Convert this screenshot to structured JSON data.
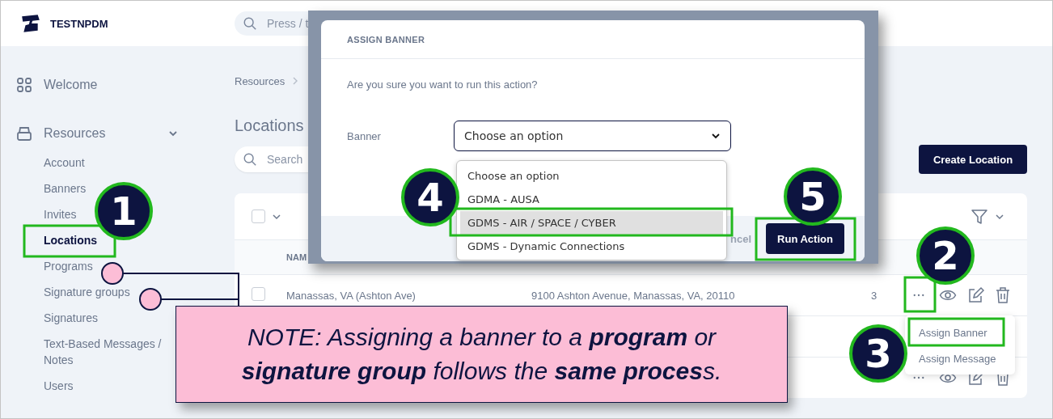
{
  "header": {
    "brand": "TESTNPDM",
    "search_placeholder": "Press / t"
  },
  "sidebar": {
    "items": [
      {
        "label": "Welcome"
      },
      {
        "label": "Resources",
        "expanded": true,
        "children": [
          {
            "label": "Account",
            "selected": false
          },
          {
            "label": "Banners",
            "selected": false
          },
          {
            "label": "Invites",
            "selected": false
          },
          {
            "label": "Locations",
            "selected": true
          },
          {
            "label": "Programs",
            "selected": false
          },
          {
            "label": "Signature groups",
            "selected": false
          },
          {
            "label": "Signatures",
            "selected": false
          },
          {
            "label": "Text-Based Messages / Notes",
            "selected": false
          },
          {
            "label": "Users",
            "selected": false
          }
        ]
      }
    ]
  },
  "breadcrumb": [
    "Resources"
  ],
  "page_title": "Locations",
  "search": {
    "placeholder": "Search"
  },
  "create_button": "Create Location",
  "table": {
    "select_all": {
      "checked": false
    },
    "columns": [
      "NAM"
    ],
    "rows": [
      {
        "checked": false,
        "name": "Manassas, VA (Ashton Ave)",
        "address": "9100 Ashton Avenue, Manassas, VA, 20110",
        "count": "3"
      }
    ]
  },
  "row_menu": {
    "items": [
      "Assign Banner",
      "Assign Message"
    ]
  },
  "modal": {
    "title": "ASSIGN BANNER",
    "message": "Are you sure you want to run this action?",
    "field_label": "Banner",
    "select_value": "Choose an option",
    "options": [
      {
        "label": "Choose an option",
        "selected": false
      },
      {
        "label": "GDMA - AUSA",
        "selected": false
      },
      {
        "label": "GDMS - AIR / SPACE / CYBER",
        "selected": true
      },
      {
        "label": "GDMS - Dynamic Connections",
        "selected": false
      }
    ],
    "cancel": "ncel",
    "run_button": "Run Action"
  },
  "steps": [
    "1",
    "2",
    "3",
    "4",
    "5"
  ],
  "note": "NOTE: Assigning a banner to a **program** or **signature group** follows the **same proces**s."
}
